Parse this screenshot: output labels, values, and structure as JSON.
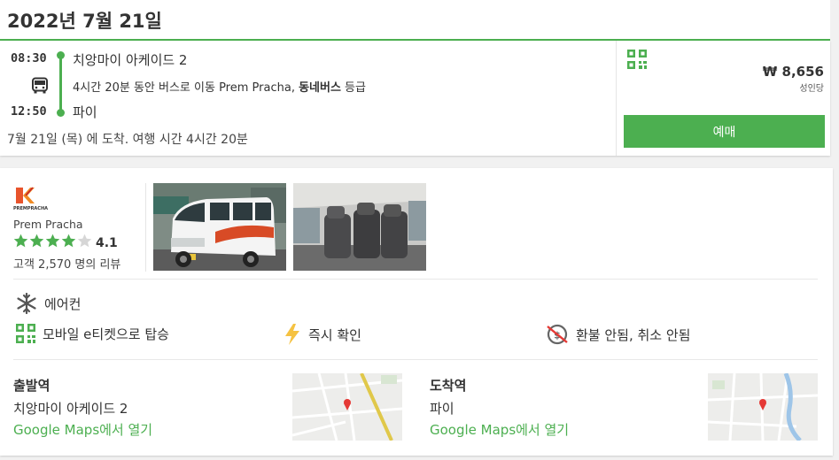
{
  "header": {
    "date": "2022년 7월 21일"
  },
  "trip": {
    "departure_time": "08:30",
    "departure_city": "치앙마이 아케이드 2",
    "duration_text": "4시간 20분 동안 버스로 이동 Prem Pracha, ",
    "class_label": "동네버스",
    "class_suffix": " 등급",
    "arrival_time": "12:50",
    "arrival_city": "파이",
    "arrival_note": "7월 21일 (목) 에 도착. 여행 시간 4시간 20분",
    "price": "₩ 8,656",
    "per_person": "성인당",
    "book_label": "예매"
  },
  "operator": {
    "name": "Prem Pracha",
    "logo_text": "PREMPRACHA",
    "rating": "4.1",
    "rating_value": 4.1,
    "stars_max": 5,
    "reviews": "고객 2,570 명의 리뷰"
  },
  "features": {
    "ac": "에어컨",
    "eticket": "모바일 e티켓으로 탑승",
    "instant": "즉시 확인",
    "refund": "환불 안됨, 취소 안됨"
  },
  "departure_station": {
    "label": "출발역",
    "name": "치앙마이 아케이드 2",
    "link": "Google Maps에서 열기"
  },
  "arrival_station": {
    "label": "도착역",
    "name": "파이",
    "link": "Google Maps에서 열기"
  },
  "colors": {
    "accent": "#4caf50",
    "star": "#4caf50",
    "lightning": "#f5c242"
  },
  "icons": [
    "bus-icon",
    "qr-icon",
    "snowflake-icon",
    "lightning-icon",
    "no-refund-icon",
    "map-pin-icon"
  ]
}
